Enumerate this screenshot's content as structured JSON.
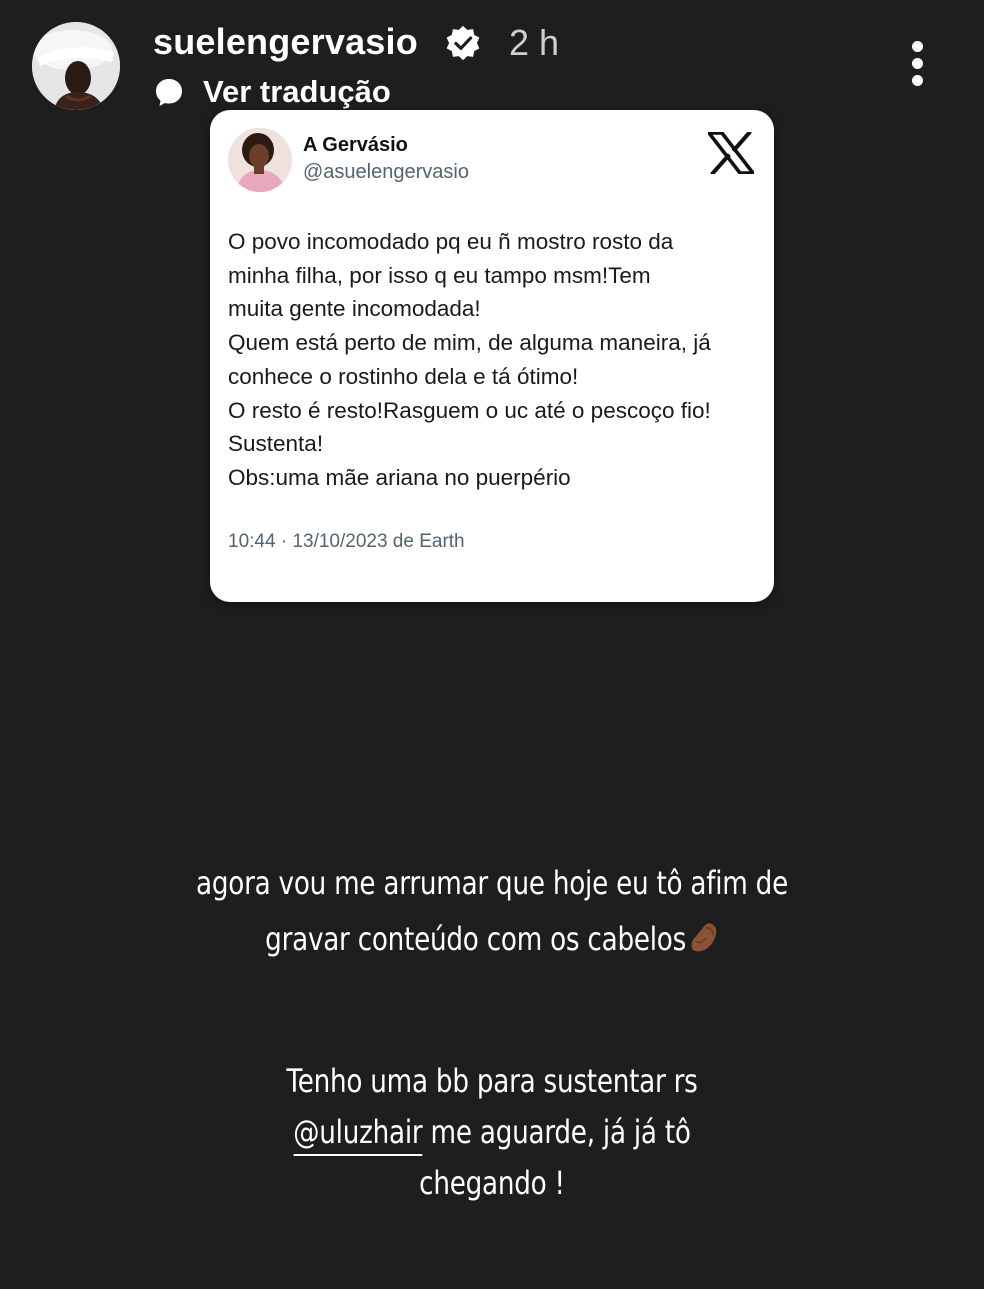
{
  "header": {
    "username": "suelengervasio",
    "time": "2 h",
    "translate_label": "Ver tradução"
  },
  "tweet": {
    "name": "A Gervásio",
    "handle": "@asuelengervasio",
    "lines": [
      "O povo incomodado pq eu ñ mostro rosto da",
      "minha filha, por isso q eu tampo msm!Tem",
      "muita gente incomodada!",
      "Quem está perto de mim, de alguma maneira, já",
      "conhece o rostinho dela e tá ótimo!",
      "O resto é resto!Rasguem o uc até o pescoço fio!",
      "Sustenta!",
      "Obs:uma mãe ariana no puerpério"
    ],
    "meta": "10:44 · 13/10/2023 de Earth"
  },
  "caption1": {
    "line1": "agora vou me arrumar que hoje eu tô afim de",
    "line2": "gravar conteúdo com os cabelos"
  },
  "caption2": {
    "line1": "Tenho uma bb para sustentar rs",
    "mention": "@uluzhair",
    "line2_rest": " me aguarde, já já tô",
    "line3": "chegando !"
  },
  "icons": {
    "verified": "verified-badge-icon",
    "more": "more-vertical-icon",
    "translate": "speech-bubble-icon",
    "x_logo": "x-logo-icon",
    "emoji": "pinched-fingers-emoji-icon"
  },
  "colors": {
    "background": "#1e1e1e",
    "card": "#ffffff",
    "secondary_text": "#536471",
    "emoji_skin": "#8a5432"
  }
}
